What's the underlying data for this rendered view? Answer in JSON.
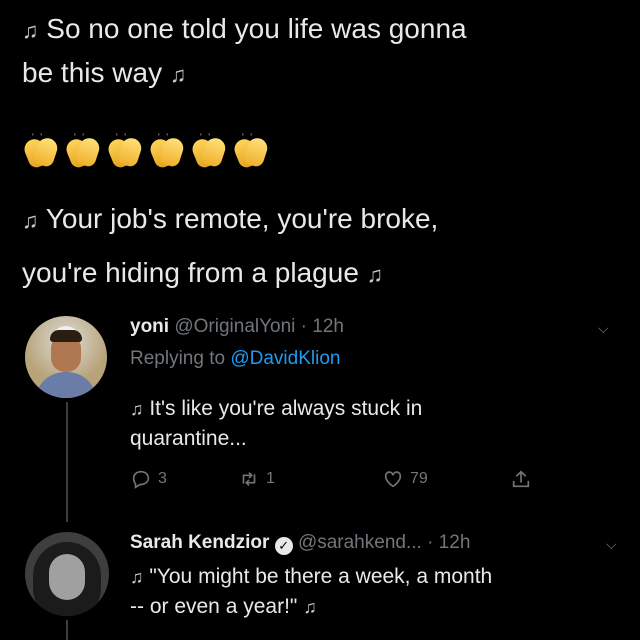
{
  "main_tweet": {
    "line1": "So no one told you life was gonna",
    "line2": "be this way",
    "line3": "Your job's remote, you're broke,",
    "line4": "you're hiding from a plague",
    "note_glyph": "♫",
    "clap_count": 6
  },
  "reply1": {
    "name": "yoni",
    "handle": "@OriginalYoni",
    "time": "· 12h",
    "replying_prefix": "Replying to",
    "replying_to": "@DavidKlion",
    "text_line1": "It's like you're always stuck in",
    "text_line2": "quarantine...",
    "replies": "3",
    "retweets": "1",
    "likes": "79"
  },
  "reply2": {
    "name": "Sarah Kendzior",
    "handle": "@sarahkend...",
    "time": "· 12h",
    "text_line1": "\"You might be there a week, a month",
    "text_line2": "-- or even a year!\""
  },
  "icons": {
    "reply": "reply-icon",
    "retweet": "retweet-icon",
    "like": "heart-icon",
    "share": "share-icon",
    "more": "chevron-down-icon",
    "verified": "verified-badge-icon"
  }
}
